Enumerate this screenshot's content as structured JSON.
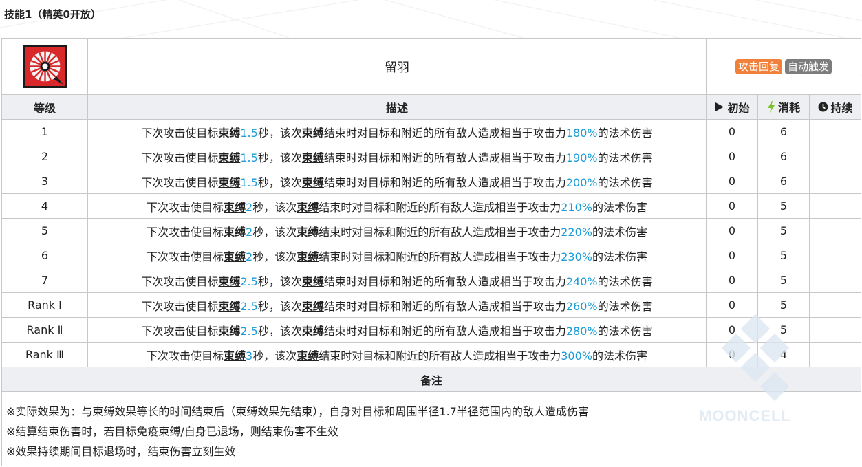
{
  "section_title": "技能1（精英0开放）",
  "skill": {
    "name": "留羽",
    "icon": "skill-feather-icon",
    "tags": [
      "攻击回复",
      "自动触发"
    ],
    "tag_colors": [
      "#f0803a",
      "#7d7d7d"
    ]
  },
  "columns": {
    "level": "等级",
    "desc": "描述",
    "init": "初始",
    "cost": "消耗",
    "duration": "持续"
  },
  "rows": [
    {
      "level": "1",
      "pre": "下次攻击使目标",
      "kw1": "束缚",
      "dur": "1.5",
      "mid": "秒，该次",
      "kw2": "束缚",
      "mid2": "结束时对目标和附近的所有敌人造成相当于攻击力",
      "pct": "180%",
      "post": "的法术伤害",
      "init": "0",
      "cost": "6",
      "duration": ""
    },
    {
      "level": "2",
      "pre": "下次攻击使目标",
      "kw1": "束缚",
      "dur": "1.5",
      "mid": "秒，该次",
      "kw2": "束缚",
      "mid2": "结束时对目标和附近的所有敌人造成相当于攻击力",
      "pct": "190%",
      "post": "的法术伤害",
      "init": "0",
      "cost": "6",
      "duration": ""
    },
    {
      "level": "3",
      "pre": "下次攻击使目标",
      "kw1": "束缚",
      "dur": "1.5",
      "mid": "秒，该次",
      "kw2": "束缚",
      "mid2": "结束时对目标和附近的所有敌人造成相当于攻击力",
      "pct": "200%",
      "post": "的法术伤害",
      "init": "0",
      "cost": "6",
      "duration": ""
    },
    {
      "level": "4",
      "pre": "下次攻击使目标",
      "kw1": "束缚",
      "dur": "2",
      "mid": "秒，该次",
      "kw2": "束缚",
      "mid2": "结束时对目标和附近的所有敌人造成相当于攻击力",
      "pct": "210%",
      "post": "的法术伤害",
      "init": "0",
      "cost": "5",
      "duration": ""
    },
    {
      "level": "5",
      "pre": "下次攻击使目标",
      "kw1": "束缚",
      "dur": "2",
      "mid": "秒，该次",
      "kw2": "束缚",
      "mid2": "结束时对目标和附近的所有敌人造成相当于攻击力",
      "pct": "220%",
      "post": "的法术伤害",
      "init": "0",
      "cost": "5",
      "duration": ""
    },
    {
      "level": "6",
      "pre": "下次攻击使目标",
      "kw1": "束缚",
      "dur": "2",
      "mid": "秒，该次",
      "kw2": "束缚",
      "mid2": "结束时对目标和附近的所有敌人造成相当于攻击力",
      "pct": "230%",
      "post": "的法术伤害",
      "init": "0",
      "cost": "5",
      "duration": ""
    },
    {
      "level": "7",
      "pre": "下次攻击使目标",
      "kw1": "束缚",
      "dur": "2.5",
      "mid": "秒，该次",
      "kw2": "束缚",
      "mid2": "结束时对目标和附近的所有敌人造成相当于攻击力",
      "pct": "240%",
      "post": "的法术伤害",
      "init": "0",
      "cost": "5",
      "duration": ""
    },
    {
      "level": "Rank Ⅰ",
      "pre": "下次攻击使目标",
      "kw1": "束缚",
      "dur": "2.5",
      "mid": "秒，该次",
      "kw2": "束缚",
      "mid2": "结束时对目标和附近的所有敌人造成相当于攻击力",
      "pct": "260%",
      "post": "的法术伤害",
      "init": "0",
      "cost": "5",
      "duration": ""
    },
    {
      "level": "Rank Ⅱ",
      "pre": "下次攻击使目标",
      "kw1": "束缚",
      "dur": "2.5",
      "mid": "秒，该次",
      "kw2": "束缚",
      "mid2": "结束时对目标和附近的所有敌人造成相当于攻击力",
      "pct": "280%",
      "post": "的法术伤害",
      "init": "0",
      "cost": "5",
      "duration": ""
    },
    {
      "level": "Rank Ⅲ",
      "pre": "下次攻击使目标",
      "kw1": "束缚",
      "dur": "3",
      "mid": "秒，该次",
      "kw2": "束缚",
      "mid2": "结束时对目标和附近的所有敌人造成相当于攻击力",
      "pct": "300%",
      "post": "的法术伤害",
      "init": "0",
      "cost": "4",
      "duration": ""
    }
  ],
  "notes": {
    "title": "备注",
    "lines": [
      "※实际效果为：与束缚效果等长的时间结束后（束缚效果先结束），自身对目标和周围半径1.7半径范围内的敌人造成伤害",
      "※结算结束伤害时，若目标免疫束缚/自身已退场，则结束伤害不生效",
      "※效果持续期间目标退场时，结束伤害立刻生效"
    ]
  },
  "watermark": "MOONCELL",
  "colors": {
    "highlight": "#1a9bd7",
    "header_bg": "#eeeff3",
    "border": "#c8c8c8",
    "init_icon": "#222222",
    "cost_icon": "#7dc22c",
    "dur_icon": "#222222"
  },
  "header_icons": [
    "play-icon",
    "lightning-icon",
    "clock-icon"
  ]
}
